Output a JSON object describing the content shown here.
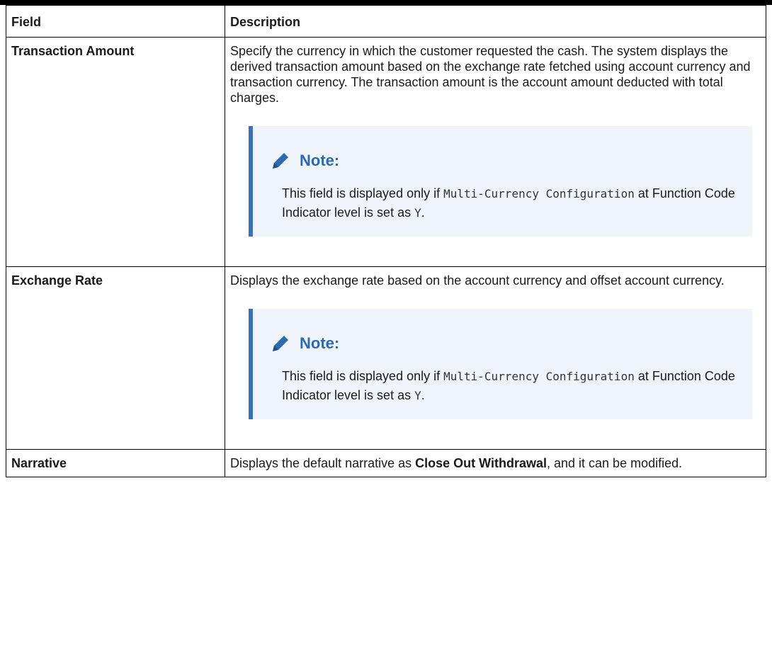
{
  "table": {
    "headers": {
      "field": "Field",
      "description": "Description"
    },
    "rows": [
      {
        "field": "Transaction Amount",
        "description": "Specify the currency in which the customer requested the cash. The system displays the derived transaction amount based on the exchange rate fetched using account currency and transaction currency. The transaction amount is the account amount deducted with total charges.",
        "note": {
          "title": "Note:",
          "text_before": "This field is displayed only if ",
          "code1": "Multi-Currency Configuration",
          "text_middle": " at Function Code Indicator level is set as ",
          "code2": "Y",
          "text_after": "."
        }
      },
      {
        "field": "Exchange Rate",
        "description": "Displays the exchange rate based on the account currency and offset account currency.",
        "note": {
          "title": "Note:",
          "text_before": "This field is displayed only if ",
          "code1": "Multi-Currency Configuration",
          "text_middle": " at Function Code Indicator level is set as ",
          "code2": "Y",
          "text_after": "."
        }
      },
      {
        "field": "Narrative",
        "description_before": "Displays the default narrative as ",
        "description_bold": "Close Out Withdrawal",
        "description_after": ", and it can be modified."
      }
    ]
  },
  "icons": {
    "note_icon": "pencil-icon",
    "note_color": "#2f6aad",
    "note_bg": "#eef4fa",
    "note_bar": "#3d6fb4"
  }
}
